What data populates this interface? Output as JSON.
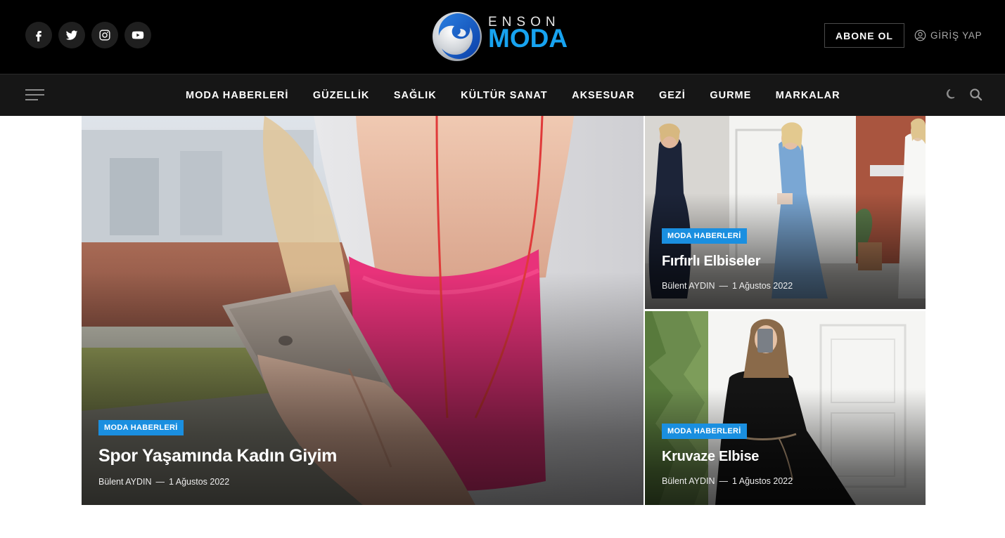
{
  "header": {
    "social": [
      {
        "name": "facebook-icon"
      },
      {
        "name": "twitter-icon"
      },
      {
        "name": "instagram-icon"
      },
      {
        "name": "youtube-icon"
      }
    ],
    "logo": {
      "top": "ENSON",
      "main": "MODA"
    },
    "subscribe_label": "ABONE OL",
    "login_label": "GİRİŞ YAP"
  },
  "nav": {
    "items": [
      "MODA HABERLERİ",
      "GÜZELLİK",
      "SAĞLIK",
      "KÜLTÜR SANAT",
      "AKSESUAR",
      "GEZİ",
      "GURME",
      "MARKALAR"
    ]
  },
  "featured": {
    "main": {
      "category": "MODA HABERLERİ",
      "title": "Spor Yaşamında Kadın Giyim",
      "author": "Bülent AYDIN",
      "separator": "—",
      "date": "1 Ağustos 2022"
    },
    "side": [
      {
        "category": "MODA HABERLERİ",
        "title": "Fırfırlı Elbiseler",
        "author": "Bülent AYDIN",
        "separator": "—",
        "date": "1 Ağustos 2022"
      },
      {
        "category": "MODA HABERLERİ",
        "title": "Kruvaze Elbise",
        "author": "Bülent AYDIN",
        "separator": "—",
        "date": "1 Ağustos 2022"
      }
    ]
  },
  "colors": {
    "header_bg": "#000000",
    "nav_bg": "#161616",
    "accent": "#1a8fe0",
    "logo_blue": "#17a3f0"
  }
}
